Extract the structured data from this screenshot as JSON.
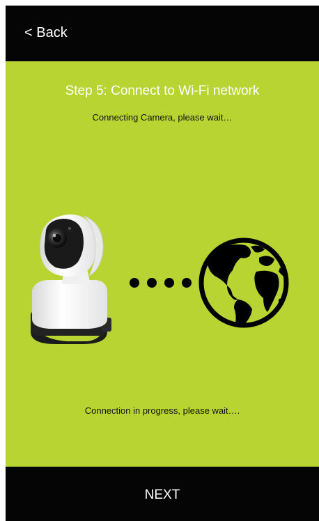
{
  "header": {
    "back_label": "< Back"
  },
  "step": {
    "title": "Step 5: Connect to Wi-Fi network",
    "subtitle": "Connecting Camera, please wait…"
  },
  "illustration": {
    "camera_icon": "camera-icon",
    "globe_icon": "globe-icon",
    "progress_dots": 4
  },
  "status_text": "Connection in progress, please wait….",
  "footer": {
    "next_label": "NEXT"
  },
  "colors": {
    "background": "#b8d432",
    "bar": "#050505",
    "title_text": "#ffffff",
    "body_text": "#111111"
  }
}
